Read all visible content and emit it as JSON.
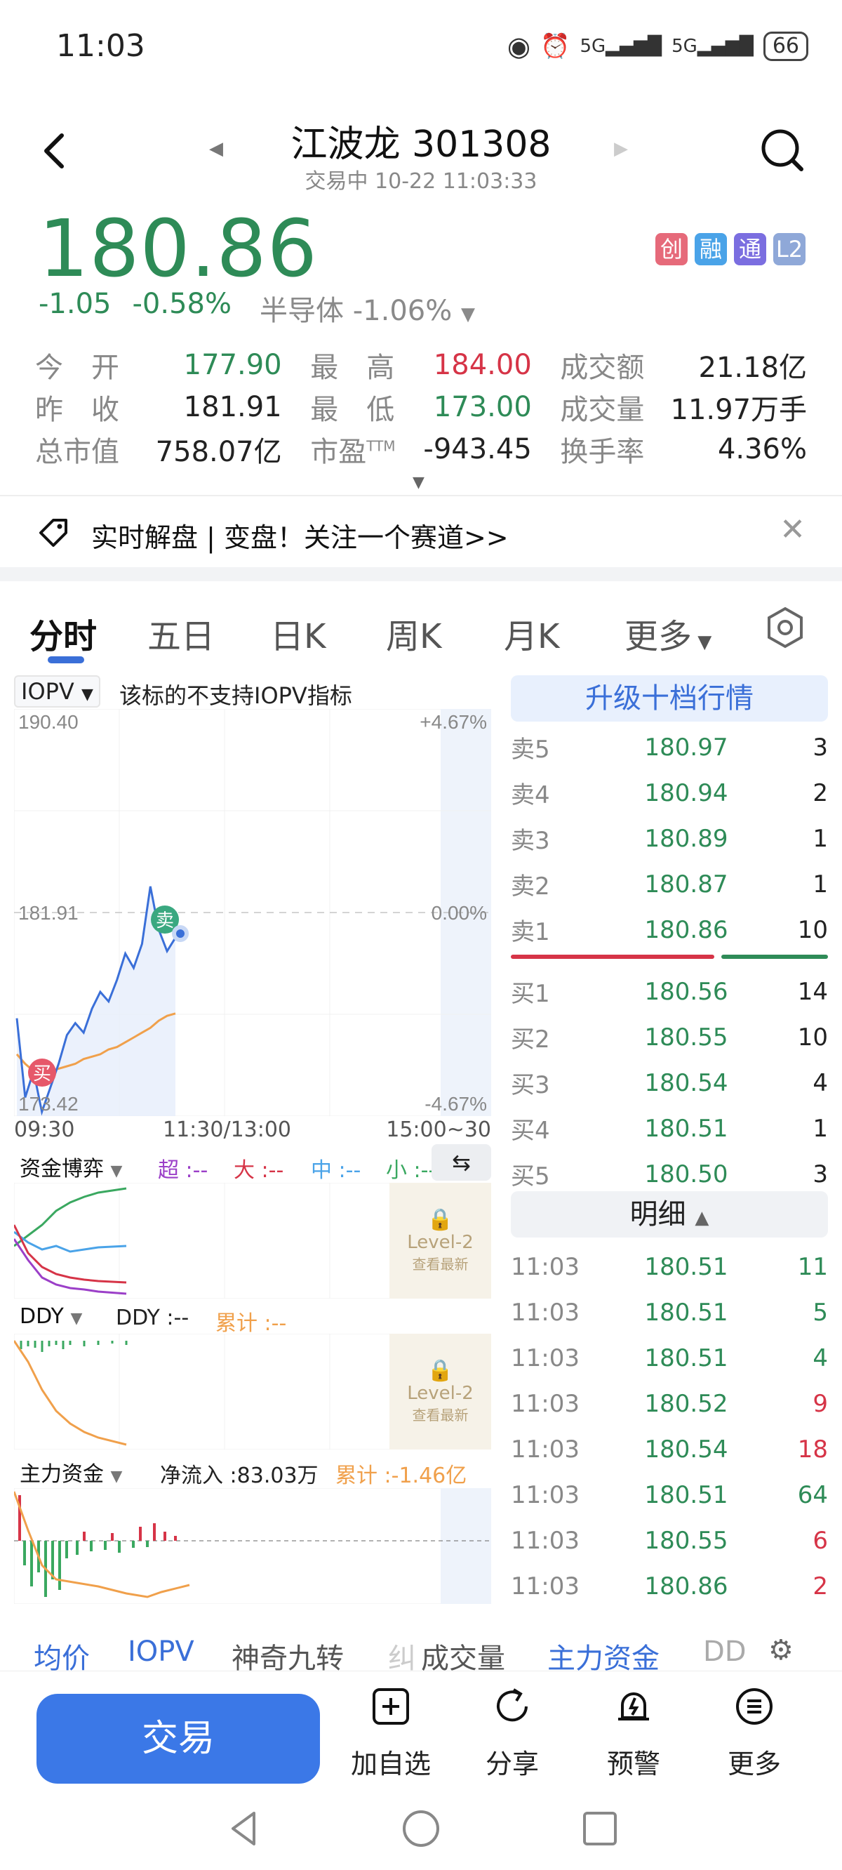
{
  "status": {
    "time": "11:03",
    "net1": "5G",
    "net2": "5G",
    "battery": "66"
  },
  "header": {
    "title": "江波龙 301308",
    "subtitle": "交易中 10-22 11:03:33"
  },
  "quote": {
    "price": "180.86",
    "change": "-1.05",
    "change_pct": "-0.58%",
    "sector": "半导体",
    "sector_pct": "-1.06%",
    "badges": [
      "创",
      "融",
      "通",
      "L2"
    ],
    "badge_colors": [
      "#e66a7a",
      "#4aa3e8",
      "#7b6ee0",
      "#8fa8d8"
    ]
  },
  "stats": {
    "open_label": "今　开",
    "open": "177.90",
    "high_label": "最　高",
    "high": "184.00",
    "amount_label": "成交额",
    "amount": "21.18亿",
    "prev_label": "昨　收",
    "prev": "181.91",
    "low_label": "最　低",
    "low": "173.00",
    "volume_label": "成交量",
    "volume": "11.97万手",
    "mcap_label": "总市值",
    "mcap": "758.07亿",
    "pe_label": "市盈",
    "pe_sup": "TTM",
    "pe": "-943.45",
    "turnover_label": "换手率",
    "turnover": "4.36%"
  },
  "banner": {
    "text": "实时解盘 | 变盘！关注一个赛道>>"
  },
  "tabs": [
    "分时",
    "五日",
    "日K",
    "周K",
    "月K",
    "更多"
  ],
  "chart": {
    "iopv_select": "IOPV",
    "iopv_note": "该标的不支持IOPV指标",
    "y_top": "190.40",
    "y_mid": "181.91",
    "y_bot": "173.42",
    "pct_top": "+4.67%",
    "pct_mid": "0.00%",
    "pct_bot": "-4.67%",
    "sell_marker": "卖",
    "buy_marker": "买",
    "time_start": "09:30",
    "time_mid": "11:30/13:00",
    "time_end": "15:00~30"
  },
  "chart_data": {
    "type": "line",
    "title": "",
    "xlabel": "",
    "ylabel": "",
    "ylim": [
      173.42,
      190.4
    ],
    "x": [
      "09:30",
      "09:35",
      "09:40",
      "09:45",
      "09:50",
      "09:55",
      "10:00",
      "10:05",
      "10:10",
      "10:15",
      "10:20",
      "10:25",
      "10:30",
      "10:35",
      "10:40",
      "10:45",
      "10:50",
      "10:55",
      "11:00",
      "11:03"
    ],
    "series": [
      {
        "values": [
          177.5,
          174.2,
          175.3,
          173.6,
          174.6,
          175.6,
          176.8,
          177.3,
          176.9,
          177.9,
          178.6,
          178.2,
          179.1,
          180.2,
          179.6,
          180.6,
          183.0,
          181.2,
          180.3,
          180.86
        ]
      },
      {
        "values": [
          176.0,
          175.6,
          175.3,
          175.2,
          175.3,
          175.4,
          175.5,
          175.6,
          175.8,
          175.9,
          176.0,
          176.2,
          176.3,
          176.5,
          176.7,
          176.9,
          177.1,
          177.4,
          177.6,
          177.7
        ]
      }
    ]
  },
  "indicators": {
    "fund_game": "资金博弈",
    "fund_super": "超 :--",
    "fund_big": "大 :--",
    "fund_mid": "中 :--",
    "fund_small": "小 :--",
    "level2": "Level-2",
    "level2_sub": "查看最新",
    "ddy_select": "DDY",
    "ddy_value": "DDY :--",
    "ddy_cum": "累计 :--",
    "main_select": "主力资金",
    "main_net": "净流入 :83.03万",
    "main_cum": "累计 :-1.46亿"
  },
  "orderbook": {
    "upgrade": "升级十档行情",
    "asks": [
      {
        "side": "卖5",
        "price": "180.97",
        "vol": "3"
      },
      {
        "side": "卖4",
        "price": "180.94",
        "vol": "2"
      },
      {
        "side": "卖3",
        "price": "180.89",
        "vol": "1"
      },
      {
        "side": "卖2",
        "price": "180.87",
        "vol": "1"
      },
      {
        "side": "卖1",
        "price": "180.86",
        "vol": "10"
      }
    ],
    "bids": [
      {
        "side": "买1",
        "price": "180.56",
        "vol": "14"
      },
      {
        "side": "买2",
        "price": "180.55",
        "vol": "10"
      },
      {
        "side": "买3",
        "price": "180.54",
        "vol": "4"
      },
      {
        "side": "买4",
        "price": "180.51",
        "vol": "1"
      },
      {
        "side": "买5",
        "price": "180.50",
        "vol": "3"
      }
    ],
    "detail_label": "明细",
    "details": [
      {
        "time": "11:03",
        "price": "180.51",
        "vol": "11",
        "color": "#2e8b57"
      },
      {
        "time": "11:03",
        "price": "180.51",
        "vol": "5",
        "color": "#2e8b57"
      },
      {
        "time": "11:03",
        "price": "180.51",
        "vol": "4",
        "color": "#2e8b57"
      },
      {
        "time": "11:03",
        "price": "180.52",
        "vol": "9",
        "color": "#d63447"
      },
      {
        "time": "11:03",
        "price": "180.54",
        "vol": "18",
        "color": "#d63447"
      },
      {
        "time": "11:03",
        "price": "180.51",
        "vol": "64",
        "color": "#2e8b57"
      },
      {
        "time": "11:03",
        "price": "180.55",
        "vol": "6",
        "color": "#d63447"
      },
      {
        "time": "11:03",
        "price": "180.86",
        "vol": "2",
        "color": "#d63447"
      }
    ]
  },
  "indicator_tabs": [
    "均价",
    "IOPV",
    "神奇九转",
    "纠",
    "成交量",
    "主力资金",
    "DD"
  ],
  "actions": {
    "trade": "交易",
    "watchlist": "加自选",
    "share": "分享",
    "alert": "预警",
    "more": "更多"
  }
}
